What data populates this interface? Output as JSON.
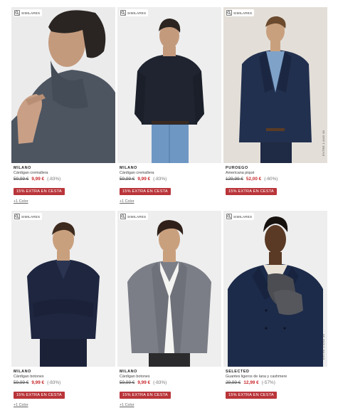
{
  "products": [
    {
      "similar_label": "SIMILARES",
      "side_note": "",
      "brand": "MILANO",
      "name": "Cárdigan cremallera",
      "old_price": "59,99 €",
      "new_price": "9,99 €",
      "discount": "(-83%)",
      "promo": "15% EXTRA EN CESTA",
      "colors": "+1 Color"
    },
    {
      "similar_label": "SIMILARES",
      "side_note": "",
      "brand": "MILANO",
      "name": "Cárdigan cremallera",
      "old_price": "59,99 €",
      "new_price": "9,99 €",
      "discount": "(-83%)",
      "promo": "15% EXTRA EN CESTA",
      "colors": "+1 Color"
    },
    {
      "similar_label": "SIMILARES",
      "side_note": "ENTRE 1 AND 38",
      "brand": "PUROEGO",
      "name": "Americana piqué",
      "old_price": "129,99 €",
      "new_price": "52,00 €",
      "discount": "(-60%)",
      "promo": "15% EXTRA EN CESTA",
      "colors": ""
    },
    {
      "similar_label": "SIMILARES",
      "side_note": "",
      "brand": "MILANO",
      "name": "Cárdigan botones",
      "old_price": "59,99 €",
      "new_price": "9,99 €",
      "discount": "(-83%)",
      "promo": "15% EXTRA EN CESTA",
      "colors": "+1 Color"
    },
    {
      "similar_label": "SIMILARES",
      "side_note": "",
      "brand": "MILANO",
      "name": "Cárdigan botones",
      "old_price": "59,99 €",
      "new_price": "9,99 €",
      "discount": "(-83%)",
      "promo": "15% EXTRA EN CESTA",
      "colors": "+1 Color"
    },
    {
      "similar_label": "SIMILARES",
      "side_note": "ENTRE 1 AND 38",
      "brand": "SELECTED",
      "name": "Guantes ligeros de lana y cashmere",
      "old_price": "29,99 €",
      "new_price": "12,99 €",
      "discount": "(-57%)",
      "promo": "15% EXTRA EN CESTA",
      "colors": ""
    }
  ],
  "colors": {
    "sale_price": "#c8282c",
    "promo_badge": "#b9353a"
  },
  "icons": {
    "similar": "similar-products-icon"
  }
}
